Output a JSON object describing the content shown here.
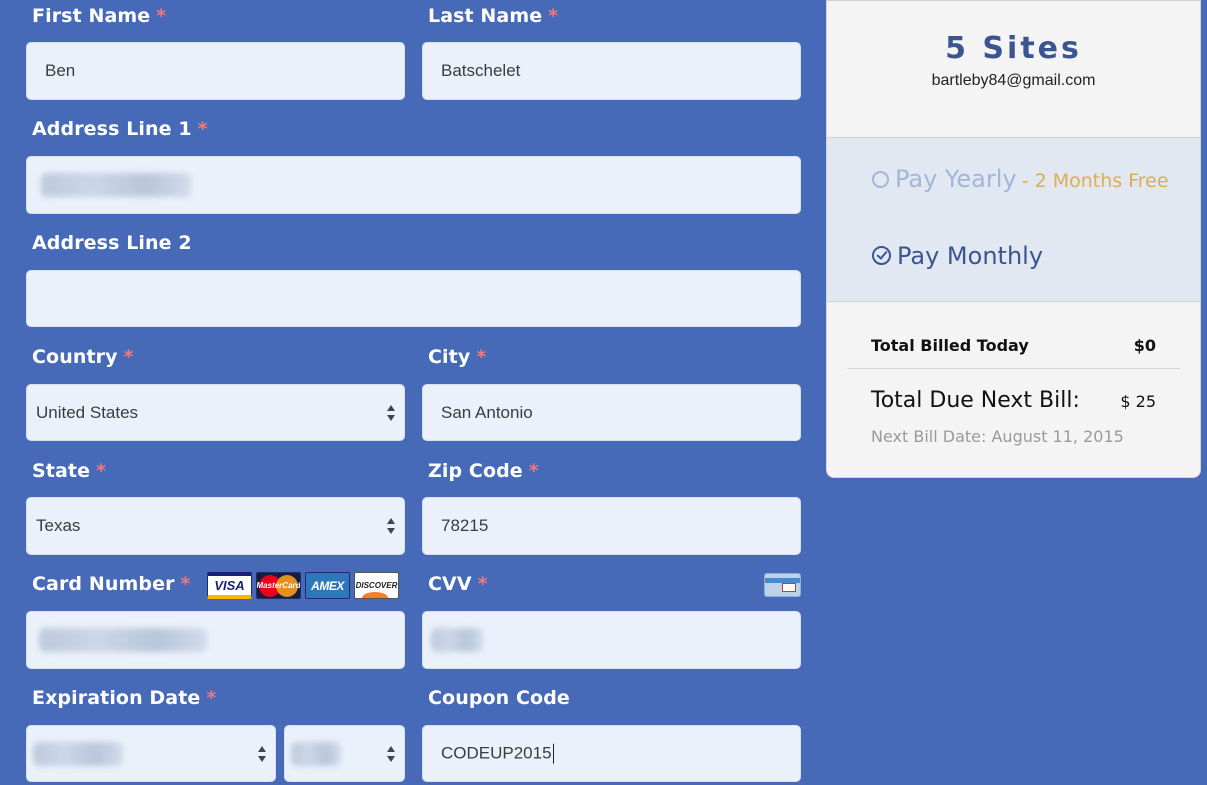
{
  "form": {
    "first_name": {
      "label": "First Name",
      "required": "*",
      "value": "Ben"
    },
    "last_name": {
      "label": "Last Name",
      "required": "*",
      "value": "Batschelet"
    },
    "address1": {
      "label": "Address Line 1",
      "required": "*",
      "value": ""
    },
    "address2": {
      "label": "Address Line 2",
      "value": ""
    },
    "country": {
      "label": "Country",
      "required": "*",
      "value": "United States"
    },
    "city": {
      "label": "City",
      "required": "*",
      "value": "San Antonio"
    },
    "state": {
      "label": "State",
      "required": "*",
      "value": "Texas"
    },
    "zip": {
      "label": "Zip Code",
      "required": "*",
      "value": "78215"
    },
    "card_number": {
      "label": "Card Number",
      "required": "*",
      "value": ""
    },
    "cvv": {
      "label": "CVV",
      "required": "*",
      "value": ""
    },
    "expiration": {
      "label": "Expiration Date",
      "required": "*"
    },
    "coupon": {
      "label": "Coupon Code",
      "value": "CODEUP2015"
    },
    "card_logos": {
      "visa": "VISA",
      "mastercard": "MasterCard",
      "amex": "AMEX",
      "discover": "DISCOVER"
    }
  },
  "summary": {
    "title": "5 Sites",
    "email": "bartleby84@gmail.com",
    "plan_yearly": "Pay Yearly",
    "plan_yearly_promo": "- 2 Months Free",
    "plan_monthly": "Pay Monthly",
    "selected_plan": "monthly",
    "total_today_label": "Total Billed Today",
    "total_today_value": "$0",
    "total_next_label": "Total Due Next Bill:",
    "total_next_value": "$ 25",
    "next_bill_date": "Next Bill Date: August 11, 2015"
  },
  "colors": {
    "background": "#466ab8",
    "field_bg": "#eaf1fa",
    "required": "#f0787a",
    "accent": "#3a5592",
    "promo": "#dcae4c"
  }
}
